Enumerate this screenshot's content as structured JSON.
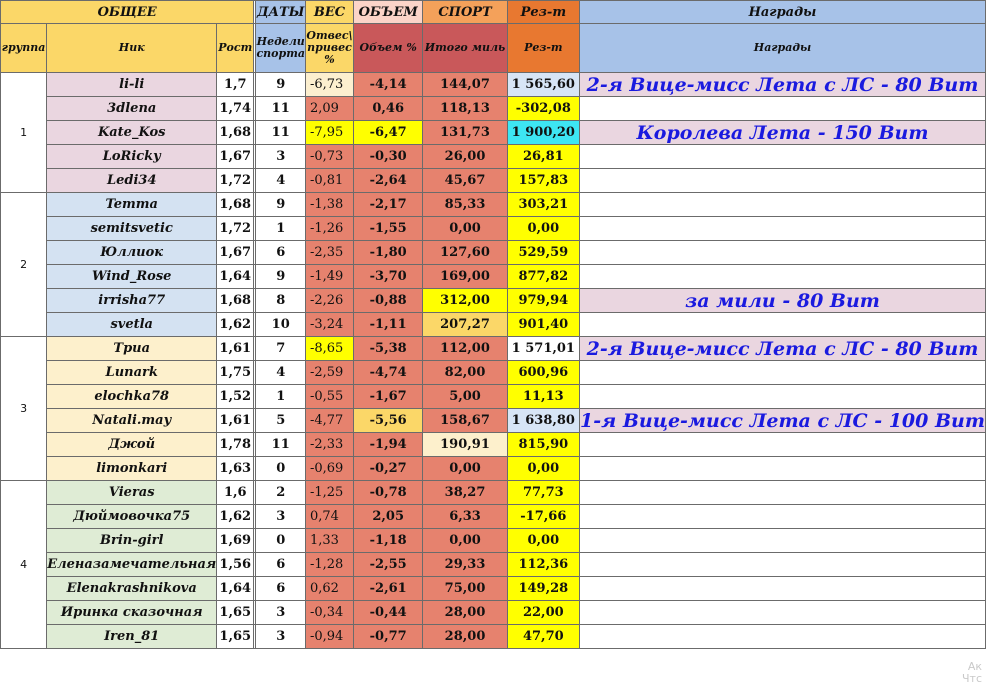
{
  "colors": {
    "gold": "#fbd768",
    "pink_hdr": "#fbd4c8",
    "orange": "#f4a15a",
    "orange_dark": "#e87830",
    "blue_hdr": "#a7c2e8",
    "red_col": "#e6826e",
    "group1": "#ead6e0",
    "group2": "#d4e2f2",
    "group3": "#fdf0cc",
    "group4": "#dfecd5",
    "yellow": "#ffff00",
    "award_text": "#1a1adf"
  },
  "header1": {
    "general": "ОБЩЕЕ",
    "dates": "ДАТЫ",
    "weight": "ВЕС",
    "volume": "ОБЪЕМ",
    "sport": "СПОРТ",
    "result": "Рез-т",
    "awards": "Награды"
  },
  "header2": {
    "group": "группа",
    "nick": "Ник",
    "height": "Рост",
    "weeks": "Недели спорта",
    "weight_change": "Отвес\\ привес %",
    "volume_pct": "Объем %",
    "total_miles": "Итого миль",
    "result": "Рез-т",
    "awards": "Награды"
  },
  "groups": [
    {
      "label": "1",
      "start": 0,
      "span": 5
    },
    {
      "label": "2",
      "start": 5,
      "span": 6
    },
    {
      "label": "3",
      "start": 11,
      "span": 6
    },
    {
      "label": "4",
      "start": 17,
      "span": 7
    }
  ],
  "rows": [
    {
      "nick": "li-li",
      "height": "1,7",
      "weeks": "9",
      "weight": "-6,73",
      "volume": "-4,14",
      "miles": "144,07",
      "result": "1 565,60",
      "award": "2-я Вице-мисс Лета с ЛС - 80 Вит"
    },
    {
      "nick": "3dlena",
      "height": "1,74",
      "weeks": "11",
      "weight": "2,09",
      "volume": "0,46",
      "miles": "118,13",
      "result": "-302,08",
      "award": ""
    },
    {
      "nick": "Kate_Kos",
      "height": "1,68",
      "weeks": "11",
      "weight": "-7,95",
      "volume": "-6,47",
      "miles": "131,73",
      "result": "1 900,20",
      "award": "Королева Лета - 150 Вит"
    },
    {
      "nick": "LoRicky",
      "height": "1,67",
      "weeks": "3",
      "weight": "-0,73",
      "volume": "-0,30",
      "miles": "26,00",
      "result": "26,81",
      "award": ""
    },
    {
      "nick": "Ledi34",
      "height": "1,72",
      "weeks": "4",
      "weight": "-0,81",
      "volume": "-2,64",
      "miles": "45,67",
      "result": "157,83",
      "award": ""
    },
    {
      "nick": "Temma",
      "height": "1,68",
      "weeks": "9",
      "weight": "-1,38",
      "volume": "-2,17",
      "miles": "85,33",
      "result": "303,21",
      "award": ""
    },
    {
      "nick": "semitsvetic",
      "height": "1,72",
      "weeks": "1",
      "weight": "-1,26",
      "volume": "-1,55",
      "miles": "0,00",
      "result": "0,00",
      "award": ""
    },
    {
      "nick": "Юллиок",
      "height": "1,67",
      "weeks": "6",
      "weight": "-2,35",
      "volume": "-1,80",
      "miles": "127,60",
      "result": "529,59",
      "award": ""
    },
    {
      "nick": "Wind_Rose",
      "height": "1,64",
      "weeks": "9",
      "weight": "-1,49",
      "volume": "-3,70",
      "miles": "169,00",
      "result": "877,82",
      "award": ""
    },
    {
      "nick": "irrisha77",
      "height": "1,68",
      "weeks": "8",
      "weight": "-2,26",
      "volume": "-0,88",
      "miles": "312,00",
      "result": "979,94",
      "award": "за мили - 80 Вит"
    },
    {
      "nick": "svetla",
      "height": "1,62",
      "weeks": "10",
      "weight": "-3,24",
      "volume": "-1,11",
      "miles": "207,27",
      "result": "901,40",
      "award": ""
    },
    {
      "nick": "Триа",
      "height": "1,61",
      "weeks": "7",
      "weight": "-8,65",
      "volume": "-5,38",
      "miles": "112,00",
      "result": "1 571,01",
      "award": "2-я Вице-мисс Лета с ЛС - 80 Вит"
    },
    {
      "nick": "Lunark",
      "height": "1,75",
      "weeks": "4",
      "weight": "-2,59",
      "volume": "-4,74",
      "miles": "82,00",
      "result": "600,96",
      "award": ""
    },
    {
      "nick": "elochka78",
      "height": "1,52",
      "weeks": "1",
      "weight": "-0,55",
      "volume": "-1,67",
      "miles": "5,00",
      "result": "11,13",
      "award": ""
    },
    {
      "nick": "Natali.may",
      "height": "1,61",
      "weeks": "5",
      "weight": "-4,77",
      "volume": "-5,56",
      "miles": "158,67",
      "result": "1 638,80",
      "award": "1-я Вице-мисс Лета с ЛС - 100 Вит"
    },
    {
      "nick": "Джой",
      "height": "1,78",
      "weeks": "11",
      "weight": "-2,33",
      "volume": "-1,94",
      "miles": "190,91",
      "result": "815,90",
      "award": ""
    },
    {
      "nick": "limonkari",
      "height": "1,63",
      "weeks": "0",
      "weight": "-0,69",
      "volume": "-0,27",
      "miles": "0,00",
      "result": "0,00",
      "award": ""
    },
    {
      "nick": "Vieras",
      "height": "1,6",
      "weeks": "2",
      "weight": "-1,25",
      "volume": "-0,78",
      "miles": "38,27",
      "result": "77,73",
      "award": ""
    },
    {
      "nick": "Дюймовочка75",
      "height": "1,62",
      "weeks": "3",
      "weight": "0,74",
      "volume": "2,05",
      "miles": "6,33",
      "result": "-17,66",
      "award": ""
    },
    {
      "nick": "Brin-girl",
      "height": "1,69",
      "weeks": "0",
      "weight": "1,33",
      "volume": "-1,18",
      "miles": "0,00",
      "result": "0,00",
      "award": ""
    },
    {
      "nick": "Еленазамечательная",
      "height": "1,56",
      "weeks": "6",
      "weight": "-1,28",
      "volume": "-2,55",
      "miles": "29,33",
      "result": "112,36",
      "award": ""
    },
    {
      "nick": "Elenakrashnikova",
      "height": "1,64",
      "weeks": "6",
      "weight": "0,62",
      "volume": "-2,61",
      "miles": "75,00",
      "result": "149,28",
      "award": ""
    },
    {
      "nick": "Иринка сказочная",
      "height": "1,65",
      "weeks": "3",
      "weight": "-0,34",
      "volume": "-0,44",
      "miles": "28,00",
      "result": "22,00",
      "award": ""
    },
    {
      "nick": "Iren_81",
      "height": "1,65",
      "weeks": "3",
      "weight": "-0,94",
      "volume": "-0,77",
      "miles": "28,00",
      "result": "47,70",
      "award": ""
    }
  ],
  "row_styles": [
    {
      "nick": "group1",
      "weight": "#fcefcf",
      "volume": "red_col",
      "miles": "red_col",
      "result": "#d7e5f6",
      "award": "#ead6e0"
    },
    {
      "nick": "group1",
      "weight": "red_col",
      "volume": "red_col",
      "miles": "red_col",
      "result": "yellow",
      "award": "#ffffff"
    },
    {
      "nick": "group1",
      "weight": "yellow",
      "volume": "yellow",
      "miles": "red_col",
      "result": "#3de6f3",
      "award": "#ead6e0"
    },
    {
      "nick": "group1",
      "weight": "red_col",
      "volume": "red_col",
      "miles": "red_col",
      "result": "yellow",
      "award": "#ffffff"
    },
    {
      "nick": "group1",
      "weight": "red_col",
      "volume": "red_col",
      "miles": "red_col",
      "result": "yellow",
      "award": "#ffffff"
    },
    {
      "nick": "group2",
      "weight": "red_col",
      "volume": "red_col",
      "miles": "red_col",
      "result": "yellow",
      "award": "#ffffff"
    },
    {
      "nick": "group2",
      "weight": "red_col",
      "volume": "red_col",
      "miles": "red_col",
      "result": "yellow",
      "award": "#ffffff"
    },
    {
      "nick": "group2",
      "weight": "red_col",
      "volume": "red_col",
      "miles": "red_col",
      "result": "yellow",
      "award": "#ffffff"
    },
    {
      "nick": "group2",
      "weight": "red_col",
      "volume": "red_col",
      "miles": "red_col",
      "result": "yellow",
      "award": "#ffffff"
    },
    {
      "nick": "group2",
      "weight": "red_col",
      "volume": "red_col",
      "miles": "yellow",
      "result": "yellow",
      "award": "#ead6e0"
    },
    {
      "nick": "group2",
      "weight": "red_col",
      "volume": "red_col",
      "miles": "#fbd768",
      "result": "yellow",
      "award": "#ffffff"
    },
    {
      "nick": "group3",
      "weight": "yellow",
      "volume": "red_col",
      "miles": "red_col",
      "result": "#ffffff",
      "award": "#ead6e0"
    },
    {
      "nick": "group3",
      "weight": "red_col",
      "volume": "red_col",
      "miles": "red_col",
      "result": "yellow",
      "award": "#ffffff"
    },
    {
      "nick": "group3",
      "weight": "red_col",
      "volume": "red_col",
      "miles": "red_col",
      "result": "yellow",
      "award": "#ffffff"
    },
    {
      "nick": "group3",
      "weight": "red_col",
      "volume": "#fbd768",
      "miles": "red_col",
      "result": "#d7e5f6",
      "award": "#ead6e0"
    },
    {
      "nick": "group3",
      "weight": "red_col",
      "volume": "red_col",
      "miles": "#fdf0cc",
      "result": "yellow",
      "award": "#ffffff"
    },
    {
      "nick": "group3",
      "weight": "red_col",
      "volume": "red_col",
      "miles": "red_col",
      "result": "yellow",
      "award": "#ffffff"
    },
    {
      "nick": "group4",
      "weight": "red_col",
      "volume": "red_col",
      "miles": "red_col",
      "result": "yellow",
      "award": "#ffffff"
    },
    {
      "nick": "group4",
      "weight": "red_col",
      "volume": "red_col",
      "miles": "red_col",
      "result": "yellow",
      "award": "#ffffff"
    },
    {
      "nick": "group4",
      "weight": "red_col",
      "volume": "red_col",
      "miles": "red_col",
      "result": "yellow",
      "award": "#ffffff"
    },
    {
      "nick": "group4",
      "weight": "red_col",
      "volume": "red_col",
      "miles": "red_col",
      "result": "yellow",
      "award": "#ffffff"
    },
    {
      "nick": "group4",
      "weight": "red_col",
      "volume": "red_col",
      "miles": "red_col",
      "result": "yellow",
      "award": "#ffffff"
    },
    {
      "nick": "group4",
      "weight": "red_col",
      "volume": "red_col",
      "miles": "red_col",
      "result": "yellow",
      "award": "#ffffff"
    },
    {
      "nick": "group4",
      "weight": "red_col",
      "volume": "red_col",
      "miles": "red_col",
      "result": "yellow",
      "award": "#ffffff"
    }
  ]
}
